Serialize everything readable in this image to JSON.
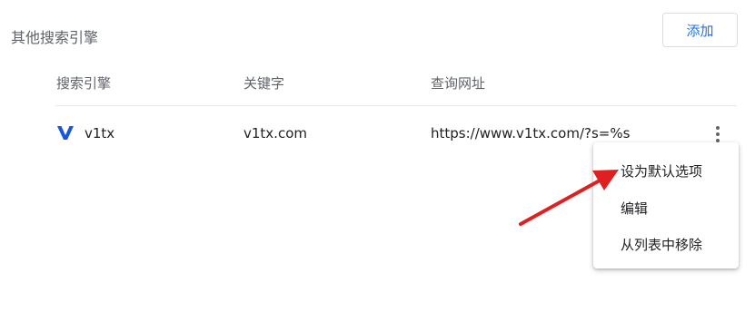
{
  "section": {
    "title": "其他搜索引擎",
    "add_label": "添加"
  },
  "columns": {
    "engine": "搜索引擎",
    "keyword": "关键字",
    "url": "查询网址"
  },
  "rows": [
    {
      "logo_letter": "V",
      "name": "v1tx",
      "keyword": "v1tx.com",
      "url": "https://www.v1tx.com/?s=%s"
    }
  ],
  "menu": {
    "items": [
      {
        "label": "设为默认选项"
      },
      {
        "label": "编辑"
      },
      {
        "label": "从列表中移除"
      }
    ]
  },
  "colors": {
    "accent": "#1a73e8",
    "logo": "#1a56db",
    "annotation_arrow": "#e02020"
  },
  "icons": {
    "row_menu": "more-vert-icon",
    "annotation": "red-arrow-icon"
  }
}
